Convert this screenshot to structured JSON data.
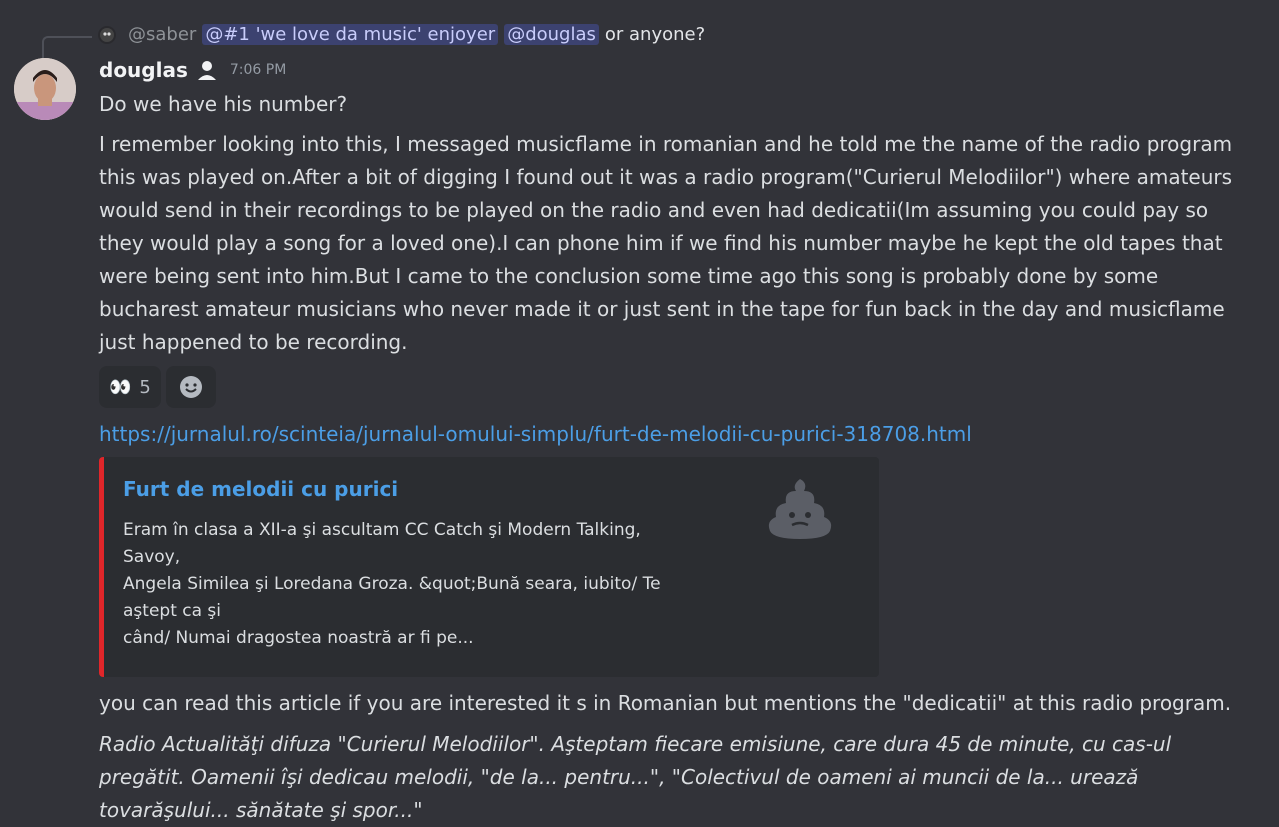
{
  "reply": {
    "user": "@saber",
    "mentions": [
      "@#1 'we love da music' enjoyer",
      "@douglas"
    ],
    "text": "or anyone?"
  },
  "message": {
    "username": "douglas",
    "timestamp": "7:06 PM",
    "line1": "Do we have his number?",
    "paragraph": "I remember looking into this, I messaged musicflame in romanian and he told me the name of the radio program this was played on.After a bit of digging I found out it was a radio program(\"Curierul Melodiilor\") where amateurs would send in their recordings to be played on the radio and even had dedicatii(Im assuming you could pay so they would play a song for a loved one).I can phone him if we find his number maybe he kept the old tapes that were being sent into him.But I came to the conclusion some time ago this song is probably done by some bucharest amateur musicians who never made it or just sent in the tape for fun back in the day and musicflame just happened to be recording."
  },
  "reactions": [
    {
      "emoji": "👀",
      "count": "5"
    },
    {
      "emoji": "☻",
      "count": ""
    }
  ],
  "link": {
    "url": "https://jurnalul.ro/scinteia/jurnalul-omului-simplu/furt-de-melodii-cu-purici-318708.html"
  },
  "embed": {
    "title": "Furt de melodii cu purici",
    "desc_line1": "Eram în clasa a XII-a şi ascultam CC Catch şi Modern Talking,",
    "desc_line2": "Savoy,",
    "desc_line3": "Angela Similea şi Loredana Groza. &quot;Bună seara, iubito/ Te",
    "desc_line4": "aştept ca şi",
    "desc_line5": "când/ Numai dragostea noastră ar fi pe...",
    "accent_color": "#e0262a",
    "thumb_icon": "poop-icon"
  },
  "followup": {
    "text": "you can read this article if you are interested it s in Romanian but mentions the \"dedicatii\" at this radio program.",
    "quote": "Radio Actualităţi difuza \"Curierul Melodiilor\". Aşteptam fiecare emisiune, care dura 45 de minute, cu cas-ul pregătit. Oamenii îşi dedicau melodii, \"de la... pentru...\", \"Colectivul de oameni ai muncii de la... urează tovarăşului... sănătate şi spor...\""
  }
}
